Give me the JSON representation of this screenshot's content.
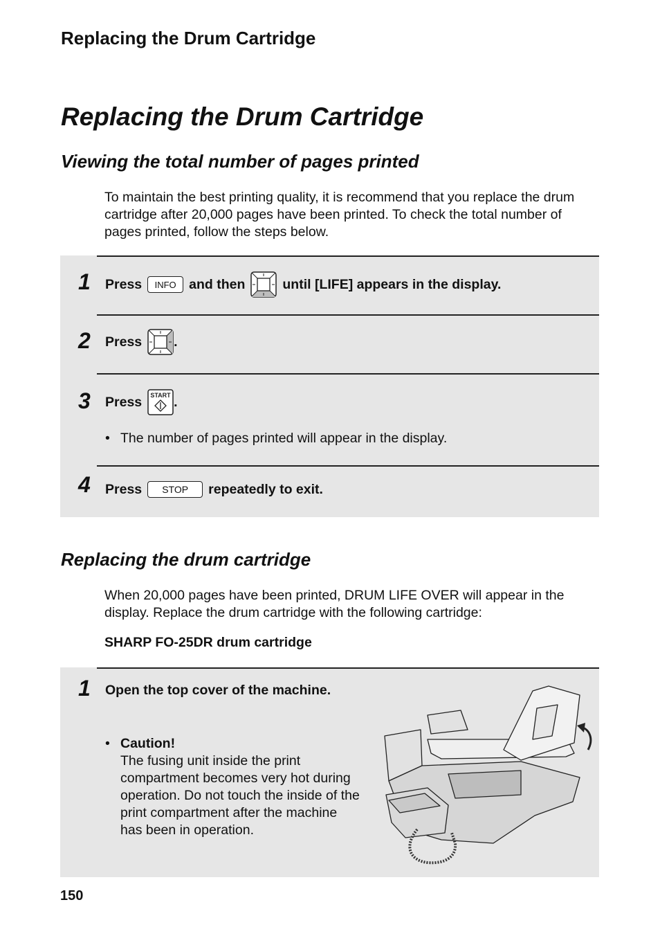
{
  "running_head": "Replacing the Drum Cartridge",
  "page_title": "Replacing the Drum Cartridge",
  "section1": {
    "heading": "Viewing the total number of pages printed",
    "intro": "To maintain the best printing quality, it is recommend that you replace the drum cartridge after 20,000 pages have been printed. To check the total number of pages printed, follow the steps below.",
    "steps": [
      {
        "num": "1",
        "press": "Press",
        "key": "INFO",
        "middle": "and then",
        "key2": "down-arrow-key",
        "tail": "until [LIFE] appears in the display."
      },
      {
        "num": "2",
        "press": "Press",
        "key": "right-arrow-key",
        "tail": "."
      },
      {
        "num": "3",
        "press": "Press",
        "key": "START",
        "tail": ".",
        "bullet": "The number of pages printed will appear in the display."
      },
      {
        "num": "4",
        "press": "Press",
        "key": "STOP",
        "tail": "repeatedly to exit."
      }
    ]
  },
  "section2": {
    "heading": "Replacing the drum cartridge",
    "intro": "When 20,000 pages have been printed, DRUM LIFE OVER will appear in the display. Replace the drum cartridge with the following cartridge:",
    "cartridge": "SHARP FO-25DR drum cartridge",
    "steps": [
      {
        "num": "1",
        "text": "Open the top cover of the machine.",
        "caution_title": "Caution!",
        "caution_lines": [
          "The fusing unit inside the print",
          "compartment becomes very hot during",
          "operation. Do not touch the inside of the",
          "print compartment after the machine",
          "has been in operation."
        ]
      }
    ],
    "illustration": "fax-machine-top-cover-open"
  },
  "page_number": "150",
  "colors": {
    "panel_bg": "#e6e6e6",
    "text": "#111111",
    "key_highlight": "#bdbdbd"
  }
}
